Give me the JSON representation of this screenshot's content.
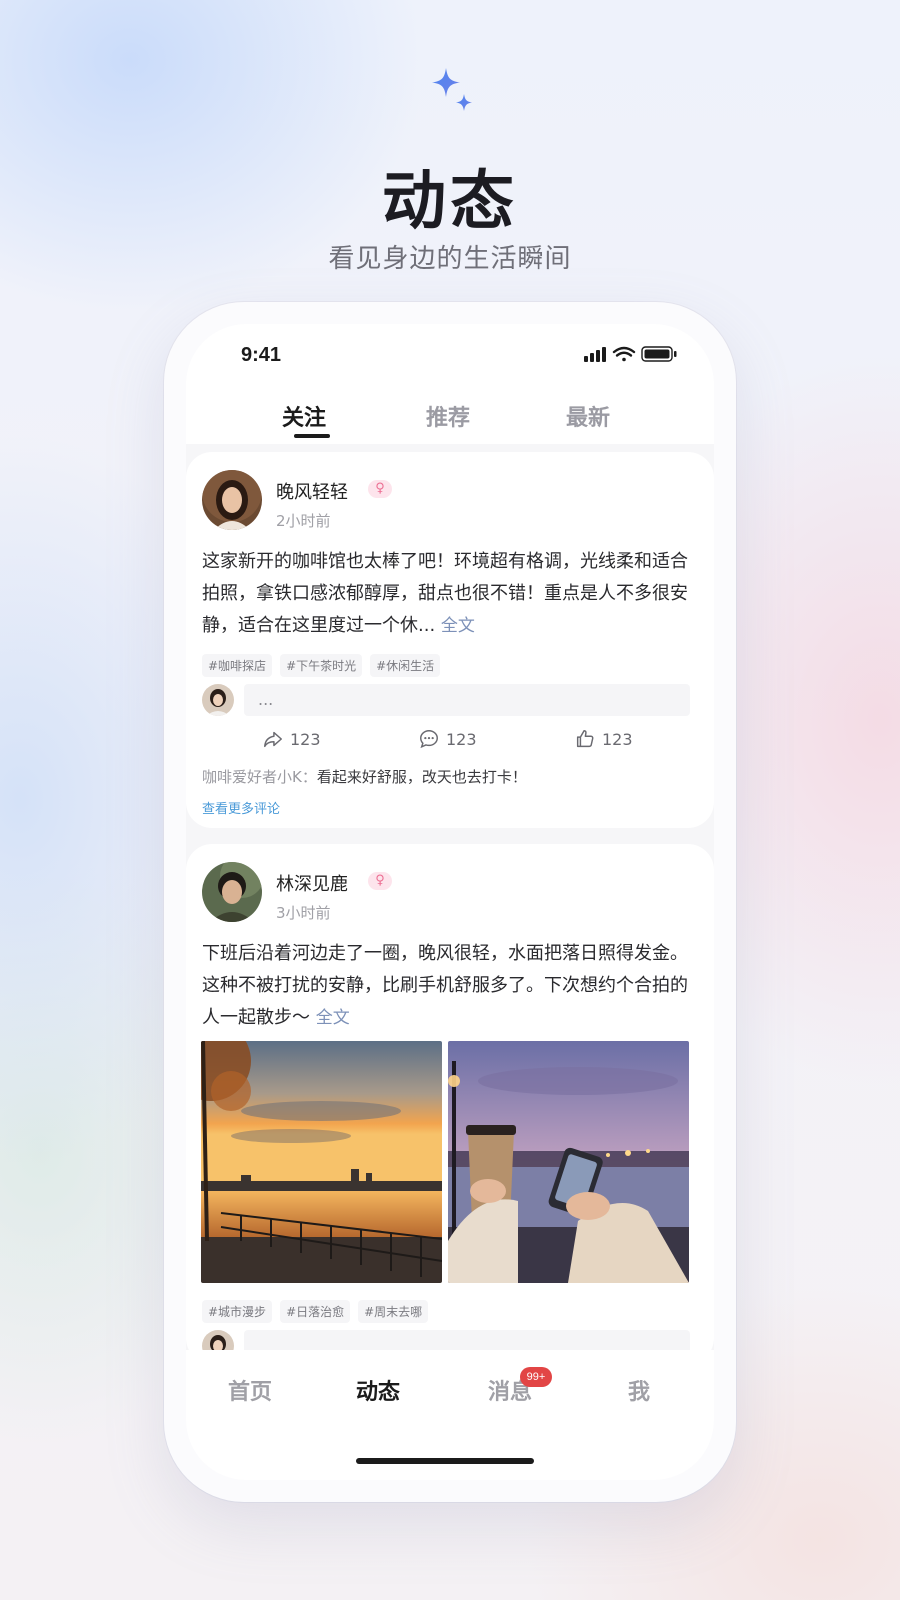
{
  "hero": {
    "icon": "sparkle-icon",
    "title": "动态",
    "subtitle": "看见身边的生活瞬间"
  },
  "status_bar": {
    "time": "9:41",
    "icons": [
      "signal-icon",
      "wifi-icon",
      "battery-icon"
    ]
  },
  "tabs": [
    {
      "label": "关注",
      "active": true
    },
    {
      "label": "推荐",
      "active": false
    },
    {
      "label": "最新",
      "active": false
    }
  ],
  "posts": [
    {
      "author": "晚风轻轻",
      "gender": "♀",
      "time": "2小时前",
      "text": "这家新开的咖啡馆也太棒了吧！环境超有格调，光线柔和适合拍照，拿铁口感浓郁醇厚，甜点也很不错！重点是人不多很安静，适合在这里度过一个休...",
      "more": "全文",
      "tags": [
        "#咖啡探店",
        "#下午茶时光",
        "#休闲生活"
      ],
      "comment_placeholder": "...",
      "actions": {
        "share": "123",
        "comment": "123",
        "like": "123"
      },
      "top_comment": {
        "user": "咖啡爱好者小K：",
        "text": "看起来好舒服，改天也去打卡！"
      },
      "see_more": "查看更多评论"
    },
    {
      "author": "林深见鹿",
      "gender": "♀",
      "time": "3小时前",
      "text": "下班后沿着河边走了一圈，晚风很轻，水面把落日照得发金。这种不被打扰的安静，比刷手机舒服多了。下次想约个合拍的人一起散步～",
      "more": "全文",
      "tags": [
        "#城市漫步",
        "#日落治愈",
        "#周末去哪"
      ]
    }
  ],
  "bottom_nav": [
    {
      "label": "首页",
      "active": false
    },
    {
      "label": "动态",
      "active": true
    },
    {
      "label": "消息",
      "active": false,
      "badge": "99+"
    },
    {
      "label": "我",
      "active": false
    }
  ],
  "colors": {
    "accent": "#4f7fe6",
    "badge": "#e24545",
    "link": "#4a9ad8"
  }
}
